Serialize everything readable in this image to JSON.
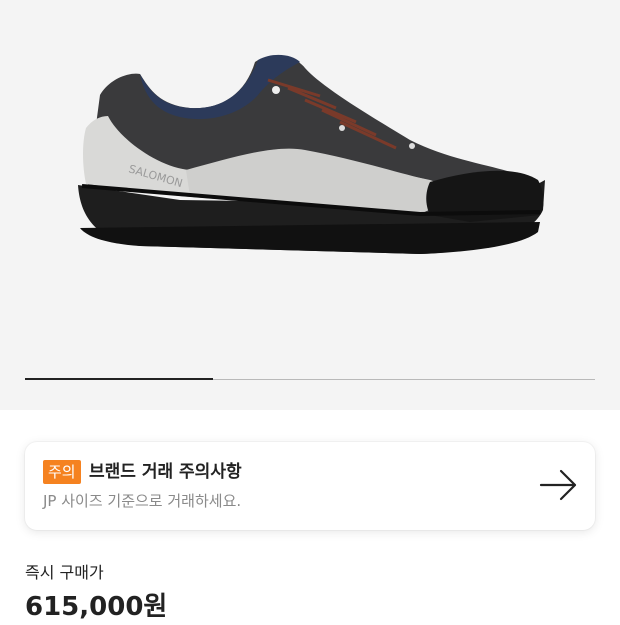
{
  "gallery": {
    "image_description": "black and grey low-top hiking shoe, side view",
    "brand_mark": "SALOMON",
    "slide_progress": 0.33
  },
  "notice": {
    "badge": "주의",
    "title": "브랜드 거래 주의사항",
    "subtitle": "JP 사이즈 기준으로 거래하세요.",
    "arrow_icon": "arrow-right-icon"
  },
  "price": {
    "label": "즉시 구매가",
    "value": "615,000원"
  },
  "colors": {
    "badge": "#f58220",
    "gallery_bg": "#f4f4f4",
    "text": "#222222",
    "subtext": "#8a8a8a"
  }
}
